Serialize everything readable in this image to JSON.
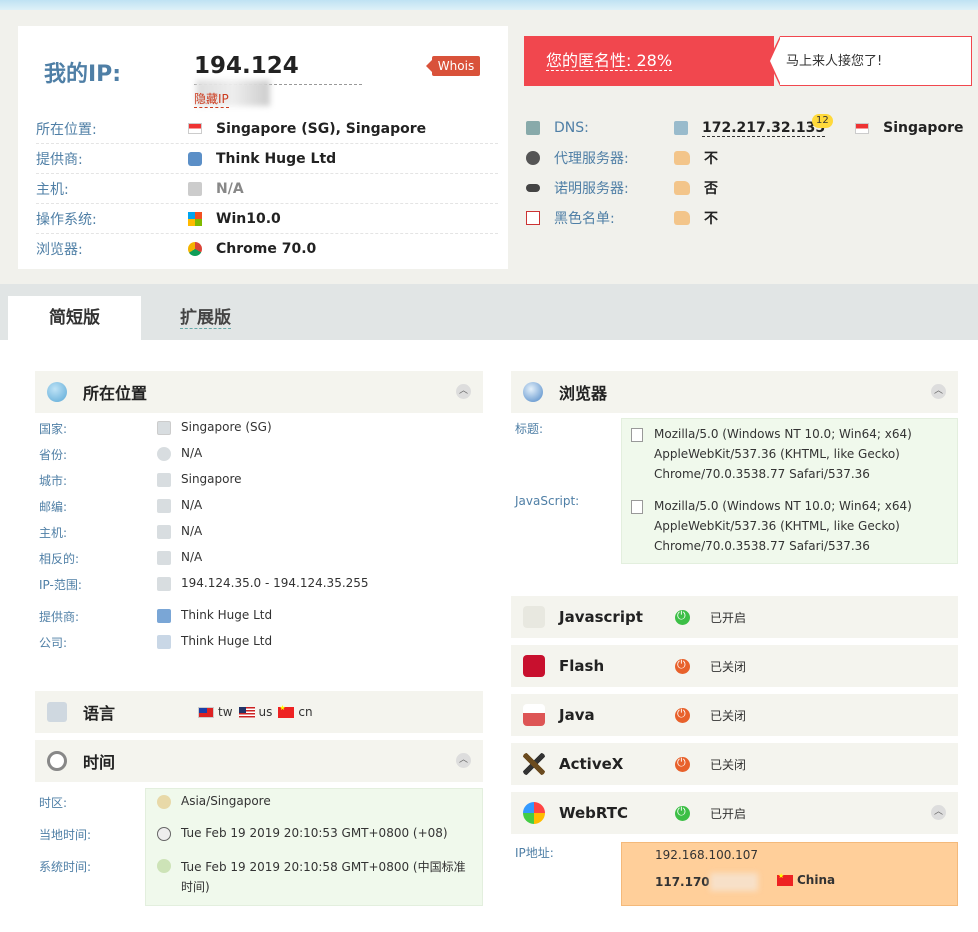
{
  "header": {
    "ip_label": "我的IP:",
    "ip_value": "194.124",
    "hide_ip": "隐藏IP",
    "whois": "Whois",
    "rows": [
      {
        "label": "所在位置:",
        "value": "Singapore (SG), Singapore",
        "icon": "flag-sg-icon"
      },
      {
        "label": "提供商:",
        "value": "Think Huge Ltd",
        "icon": "isp-icon"
      },
      {
        "label": "主机:",
        "value": "N/A",
        "icon": "host-icon"
      },
      {
        "label": "操作系统:",
        "value": "Win10.0",
        "icon": "windows-icon"
      },
      {
        "label": "浏览器:",
        "value": "Chrome 70.0",
        "icon": "chrome-icon"
      }
    ]
  },
  "anonymity": {
    "text": "您的匿名性: 28%",
    "message": "马上来人接您了!"
  },
  "right_rows": [
    {
      "label": "DNS:",
      "value": "172.217.32.135",
      "badge": "12",
      "country": "Singapore"
    },
    {
      "label": "代理服务器:",
      "value": "不"
    },
    {
      "label": "诺明服务器:",
      "value": "否"
    },
    {
      "label": "黑色名单:",
      "value": "不"
    }
  ],
  "tabs": {
    "short": "简短版",
    "extended": "扩展版"
  },
  "location": {
    "title": "所在位置",
    "rows": [
      {
        "k": "国家:",
        "v": "Singapore (SG)"
      },
      {
        "k": "省份:",
        "v": "N/A"
      },
      {
        "k": "城市:",
        "v": "Singapore"
      },
      {
        "k": "邮编:",
        "v": "N/A"
      },
      {
        "k": "主机:",
        "v": "N/A"
      },
      {
        "k": "相反的:",
        "v": "N/A"
      },
      {
        "k": "IP-范围:",
        "v": "194.124.35.0 - 194.124.35.255"
      },
      {
        "k": "提供商:",
        "v": "Think Huge Ltd"
      },
      {
        "k": "公司:",
        "v": "Think Huge Ltd"
      }
    ]
  },
  "language": {
    "title": "语言",
    "items": [
      "tw",
      "us",
      "cn"
    ]
  },
  "time": {
    "title": "时间",
    "rows": [
      {
        "k": "时区:",
        "v": "Asia/Singapore"
      },
      {
        "k": "当地时间:",
        "v": "Tue Feb 19 2019 20:10:53 GMT+0800 (+08)"
      },
      {
        "k": "系统时间:",
        "v": "Tue Feb 19 2019 20:10:58 GMT+0800 (中国标准",
        "v2": "时间)"
      }
    ]
  },
  "browser": {
    "title": "浏览器",
    "ua_label": "标题:",
    "js_label": "JavaScript:",
    "ua": [
      "Mozilla/5.0 (Windows NT 10.0; Win64; x64)",
      "AppleWebKit/537.36 (KHTML, like Gecko)",
      "Chrome/70.0.3538.77 Safari/537.36"
    ],
    "js": [
      "Mozilla/5.0 (Windows NT 10.0; Win64; x64)",
      "AppleWebKit/537.36 (KHTML, like Gecko)",
      "Chrome/70.0.3538.77 Safari/537.36"
    ]
  },
  "plugins": [
    {
      "name": "Javascript",
      "status": "已开启",
      "on": true
    },
    {
      "name": "Flash",
      "status": "已关闭",
      "on": false
    },
    {
      "name": "Java",
      "status": "已关闭",
      "on": false
    },
    {
      "name": "ActiveX",
      "status": "已关闭",
      "on": false
    },
    {
      "name": "WebRTC",
      "status": "已开启",
      "on": true
    }
  ],
  "webrtc": {
    "label": "IP地址:",
    "local_ip": "192.168.100.107",
    "public_ip": "117.170",
    "country": "China"
  }
}
